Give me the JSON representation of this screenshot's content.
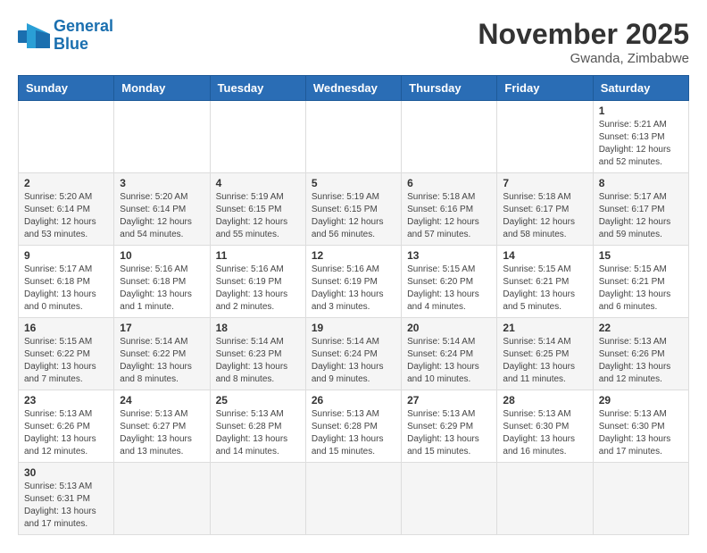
{
  "header": {
    "logo_general": "General",
    "logo_blue": "Blue",
    "month_title": "November 2025",
    "location": "Gwanda, Zimbabwe"
  },
  "weekdays": [
    "Sunday",
    "Monday",
    "Tuesday",
    "Wednesday",
    "Thursday",
    "Friday",
    "Saturday"
  ],
  "days": [
    {
      "num": "",
      "info": ""
    },
    {
      "num": "",
      "info": ""
    },
    {
      "num": "",
      "info": ""
    },
    {
      "num": "",
      "info": ""
    },
    {
      "num": "",
      "info": ""
    },
    {
      "num": "",
      "info": ""
    },
    {
      "num": "1",
      "info": "Sunrise: 5:21 AM\nSunset: 6:13 PM\nDaylight: 12 hours\nand 52 minutes."
    },
    {
      "num": "2",
      "info": "Sunrise: 5:20 AM\nSunset: 6:14 PM\nDaylight: 12 hours\nand 53 minutes."
    },
    {
      "num": "3",
      "info": "Sunrise: 5:20 AM\nSunset: 6:14 PM\nDaylight: 12 hours\nand 54 minutes."
    },
    {
      "num": "4",
      "info": "Sunrise: 5:19 AM\nSunset: 6:15 PM\nDaylight: 12 hours\nand 55 minutes."
    },
    {
      "num": "5",
      "info": "Sunrise: 5:19 AM\nSunset: 6:15 PM\nDaylight: 12 hours\nand 56 minutes."
    },
    {
      "num": "6",
      "info": "Sunrise: 5:18 AM\nSunset: 6:16 PM\nDaylight: 12 hours\nand 57 minutes."
    },
    {
      "num": "7",
      "info": "Sunrise: 5:18 AM\nSunset: 6:17 PM\nDaylight: 12 hours\nand 58 minutes."
    },
    {
      "num": "8",
      "info": "Sunrise: 5:17 AM\nSunset: 6:17 PM\nDaylight: 12 hours\nand 59 minutes."
    },
    {
      "num": "9",
      "info": "Sunrise: 5:17 AM\nSunset: 6:18 PM\nDaylight: 13 hours\nand 0 minutes."
    },
    {
      "num": "10",
      "info": "Sunrise: 5:16 AM\nSunset: 6:18 PM\nDaylight: 13 hours\nand 1 minute."
    },
    {
      "num": "11",
      "info": "Sunrise: 5:16 AM\nSunset: 6:19 PM\nDaylight: 13 hours\nand 2 minutes."
    },
    {
      "num": "12",
      "info": "Sunrise: 5:16 AM\nSunset: 6:19 PM\nDaylight: 13 hours\nand 3 minutes."
    },
    {
      "num": "13",
      "info": "Sunrise: 5:15 AM\nSunset: 6:20 PM\nDaylight: 13 hours\nand 4 minutes."
    },
    {
      "num": "14",
      "info": "Sunrise: 5:15 AM\nSunset: 6:21 PM\nDaylight: 13 hours\nand 5 minutes."
    },
    {
      "num": "15",
      "info": "Sunrise: 5:15 AM\nSunset: 6:21 PM\nDaylight: 13 hours\nand 6 minutes."
    },
    {
      "num": "16",
      "info": "Sunrise: 5:15 AM\nSunset: 6:22 PM\nDaylight: 13 hours\nand 7 minutes."
    },
    {
      "num": "17",
      "info": "Sunrise: 5:14 AM\nSunset: 6:22 PM\nDaylight: 13 hours\nand 8 minutes."
    },
    {
      "num": "18",
      "info": "Sunrise: 5:14 AM\nSunset: 6:23 PM\nDaylight: 13 hours\nand 8 minutes."
    },
    {
      "num": "19",
      "info": "Sunrise: 5:14 AM\nSunset: 6:24 PM\nDaylight: 13 hours\nand 9 minutes."
    },
    {
      "num": "20",
      "info": "Sunrise: 5:14 AM\nSunset: 6:24 PM\nDaylight: 13 hours\nand 10 minutes."
    },
    {
      "num": "21",
      "info": "Sunrise: 5:14 AM\nSunset: 6:25 PM\nDaylight: 13 hours\nand 11 minutes."
    },
    {
      "num": "22",
      "info": "Sunrise: 5:13 AM\nSunset: 6:26 PM\nDaylight: 13 hours\nand 12 minutes."
    },
    {
      "num": "23",
      "info": "Sunrise: 5:13 AM\nSunset: 6:26 PM\nDaylight: 13 hours\nand 12 minutes."
    },
    {
      "num": "24",
      "info": "Sunrise: 5:13 AM\nSunset: 6:27 PM\nDaylight: 13 hours\nand 13 minutes."
    },
    {
      "num": "25",
      "info": "Sunrise: 5:13 AM\nSunset: 6:28 PM\nDaylight: 13 hours\nand 14 minutes."
    },
    {
      "num": "26",
      "info": "Sunrise: 5:13 AM\nSunset: 6:28 PM\nDaylight: 13 hours\nand 15 minutes."
    },
    {
      "num": "27",
      "info": "Sunrise: 5:13 AM\nSunset: 6:29 PM\nDaylight: 13 hours\nand 15 minutes."
    },
    {
      "num": "28",
      "info": "Sunrise: 5:13 AM\nSunset: 6:30 PM\nDaylight: 13 hours\nand 16 minutes."
    },
    {
      "num": "29",
      "info": "Sunrise: 5:13 AM\nSunset: 6:30 PM\nDaylight: 13 hours\nand 17 minutes."
    },
    {
      "num": "30",
      "info": "Sunrise: 5:13 AM\nSunset: 6:31 PM\nDaylight: 13 hours\nand 17 minutes."
    },
    {
      "num": "",
      "info": ""
    },
    {
      "num": "",
      "info": ""
    },
    {
      "num": "",
      "info": ""
    },
    {
      "num": "",
      "info": ""
    },
    {
      "num": "",
      "info": ""
    },
    {
      "num": "",
      "info": ""
    }
  ]
}
